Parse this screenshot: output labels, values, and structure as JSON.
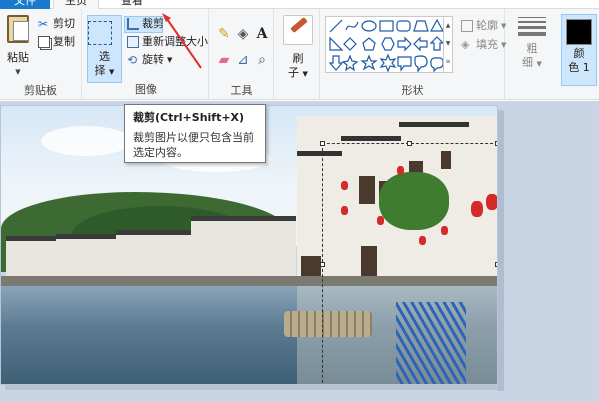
{
  "tabs": {
    "file": "文件",
    "home": "主页",
    "view": "查看"
  },
  "clipboard": {
    "paste": "粘贴",
    "cut": "剪切",
    "copy": "复制",
    "group_label": "剪贴板"
  },
  "image": {
    "select_line1": "选",
    "select_line2": "择",
    "crop": "裁剪",
    "resize": "重新调整大小",
    "rotate": "旋转",
    "group_label": "图像"
  },
  "tools": {
    "group_label": "工具",
    "text_glyph": "A"
  },
  "brushes": {
    "line1": "刷",
    "line2": "子"
  },
  "shapes": {
    "outline": "轮廓",
    "fill": "填充",
    "group_label": "形状"
  },
  "size": {
    "line1": "粗",
    "line2": "细"
  },
  "colors": {
    "color1_line1": "颜",
    "color1_line2": "色 1",
    "color1_value": "#000000"
  },
  "tooltip": {
    "title": "裁剪(Ctrl+Shift+X)",
    "body": "裁剪图片以便只包含当前选定内容。"
  },
  "annotation": {
    "arrow_color": "#e0302a"
  }
}
